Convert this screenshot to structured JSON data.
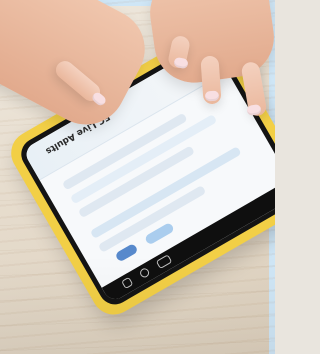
{
  "screen": {
    "title": "EC Live Adults"
  },
  "colors": {
    "phone_case": "#f2cf46",
    "background_frame": "#cfe6f6"
  }
}
